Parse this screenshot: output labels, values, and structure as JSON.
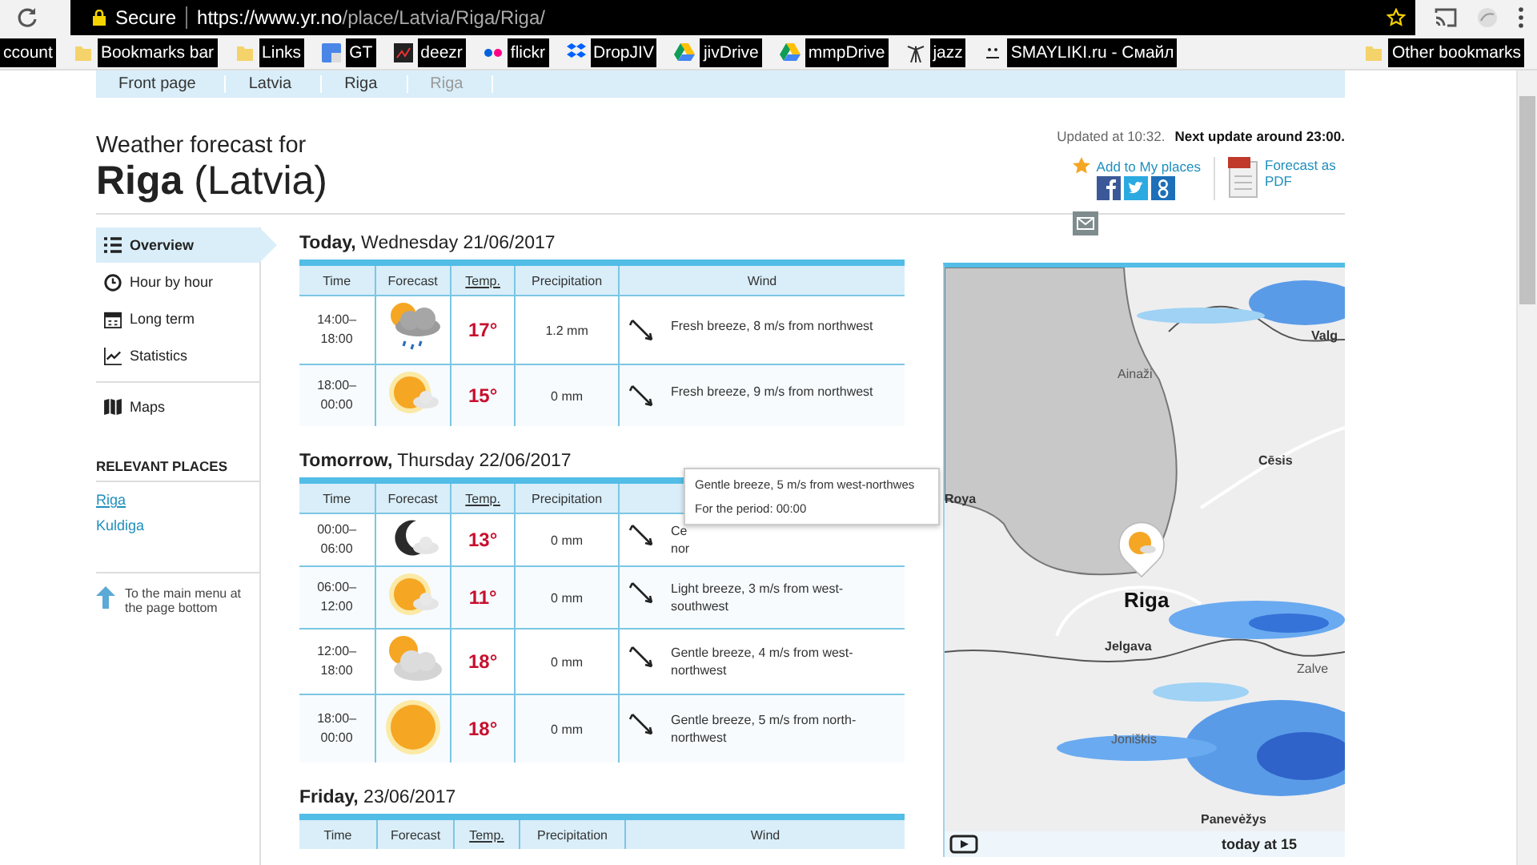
{
  "browser": {
    "secure_label": "Secure",
    "url_host": "https://www.yr.no",
    "url_path": "/place/Latvia/Riga/Riga/",
    "bookmarks": [
      {
        "label": "ccount",
        "kind": "none"
      },
      {
        "label": "Bookmarks bar",
        "kind": "folder"
      },
      {
        "label": "Links",
        "kind": "folder"
      },
      {
        "label": "GT",
        "kind": "translate"
      },
      {
        "label": "deezr",
        "kind": "chart"
      },
      {
        "label": "flickr",
        "kind": "dots"
      },
      {
        "label": "DropJIV",
        "kind": "box"
      },
      {
        "label": "jivDrive",
        "kind": "drive"
      },
      {
        "label": "mmpDrive",
        "kind": "drive"
      },
      {
        "label": "jazz",
        "kind": "tower"
      },
      {
        "label": "SMAYLIKI.ru - Смайл",
        "kind": "face"
      }
    ],
    "other_bookmarks": "Other bookmarks"
  },
  "breadcrumb": [
    {
      "label": "Front page",
      "selected": false
    },
    {
      "label": "Latvia",
      "selected": false
    },
    {
      "label": "Riga",
      "selected": false
    },
    {
      "label": "Riga",
      "selected": true
    }
  ],
  "header": {
    "subtitle": "Weather forecast for",
    "city": "Riga",
    "country": "(Latvia)",
    "updated": "Updated at 10:32.",
    "next_update": "Next update around 23:00.",
    "add_place": "Add to My places",
    "pdf_link": "Forecast as PDF"
  },
  "nav": [
    {
      "label": "Overview",
      "kind": "list",
      "selected": true
    },
    {
      "label": "Hour by hour",
      "kind": "clock",
      "selected": false
    },
    {
      "label": "Long term",
      "kind": "calendar",
      "selected": false
    },
    {
      "label": "Statistics",
      "kind": "stats",
      "selected": false
    },
    {
      "label": "Maps",
      "kind": "map",
      "selected": false
    }
  ],
  "relevant": {
    "title": "RELEVANT PLACES",
    "places": [
      "Riga",
      "Kuldiga"
    ],
    "to_menu": "To the main menu at the page bottom"
  },
  "days": [
    {
      "day": "Today,",
      "date": "Wednesday 21/06/2017",
      "columns": [
        "Time",
        "Forecast",
        "Temp.",
        "Precipitation",
        "Wind"
      ],
      "rows": [
        {
          "time": "14:00–\n18:00",
          "kind": "sun-cloud-rain",
          "temp": "17°",
          "precip": "1.2 mm",
          "wind": "Fresh breeze, 8 m/s from northwest"
        },
        {
          "time": "18:00–\n00:00",
          "kind": "sun-cloud",
          "temp": "15°",
          "precip": "0 mm",
          "wind": "Fresh breeze, 9 m/s from northwest"
        }
      ]
    },
    {
      "day": "Tomorrow,",
      "date": "Thursday 22/06/2017",
      "columns": [
        "Time",
        "Forecast",
        "Temp.",
        "Precipitation"
      ],
      "rows": [
        {
          "time": "00:00–\n06:00",
          "kind": "moon-cloud",
          "temp": "13°",
          "precip": "0 mm",
          "wind": "Ce\nnor"
        },
        {
          "time": "06:00–\n12:00",
          "kind": "sun-cloud",
          "temp": "11°",
          "precip": "0 mm",
          "wind": "Light breeze, 3 m/s from west-southwest"
        },
        {
          "time": "12:00–\n18:00",
          "kind": "sun-bigcloud",
          "temp": "18°",
          "precip": "0 mm",
          "wind": "Gentle breeze, 4 m/s from west-northwest"
        },
        {
          "time": "18:00–\n00:00",
          "kind": "sun",
          "temp": "18°",
          "precip": "0 mm",
          "wind": "Gentle breeze, 5 m/s from north-northwest"
        }
      ]
    },
    {
      "day": "Friday,",
      "date": "23/06/2017",
      "columns": [
        "Time",
        "Forecast",
        "Temp.",
        "Precipitation",
        "Wind"
      ]
    }
  ],
  "tooltip": {
    "wind": "Gentle breeze, 5 m/s from west-northwes",
    "period": "For the period: 00:00"
  },
  "map": {
    "places": [
      "Valg",
      "Ainaži",
      "Cēsis",
      "Roya",
      "Riga",
      "Jelgava",
      "Zalve",
      "Joniškis",
      "Panevėžys"
    ],
    "time_label": "today at 15"
  }
}
